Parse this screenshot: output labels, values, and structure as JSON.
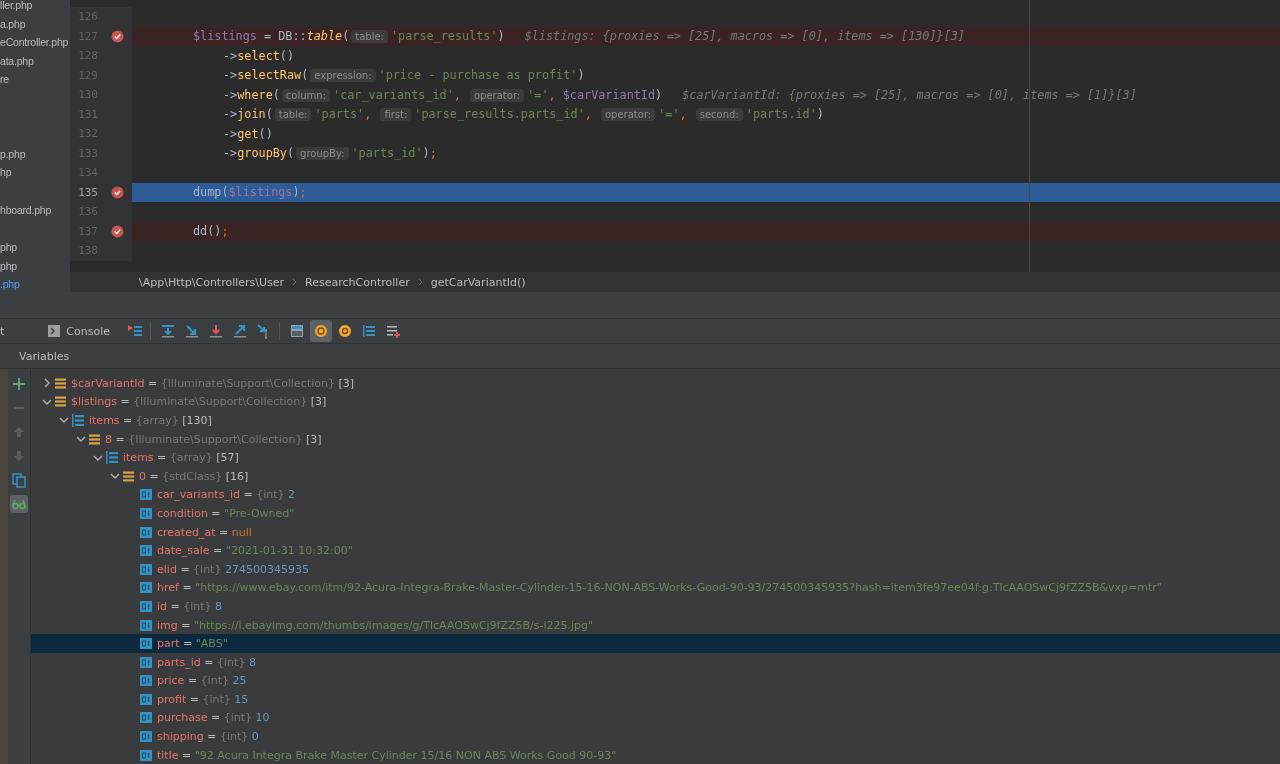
{
  "project_files": [
    {
      "label": "ller.php",
      "selected": false
    },
    {
      "label": "a.php",
      "selected": false
    },
    {
      "label": "eController.php",
      "selected": false
    },
    {
      "label": "ata.php",
      "selected": false
    },
    {
      "label": "re",
      "selected": false
    },
    {
      "label": "p.php",
      "selected": false
    },
    {
      "label": "hp",
      "selected": false
    },
    {
      "label": "hboard.php",
      "selected": false
    },
    {
      "label": "php",
      "selected": false
    },
    {
      "label": "php",
      "selected": false
    },
    {
      "label": ".php",
      "selected": true
    }
  ],
  "editor": {
    "lines": [
      {
        "number": "126",
        "kind": "statement",
        "breakpoint": false,
        "current": false
      },
      {
        "number": "127",
        "kind": "statement",
        "breakpoint": true,
        "current": false,
        "tokens": [
          {
            "kind": "var",
            "text": "$listings"
          },
          {
            "kind": "plain",
            "text": " = DB::"
          },
          {
            "kind": "fn_italic",
            "text": "table"
          },
          {
            "kind": "plain",
            "text": "("
          },
          {
            "kind": "hint",
            "text": "table:"
          },
          {
            "kind": "str",
            "text": "'parse_results'"
          },
          {
            "kind": "plain",
            "text": ")"
          }
        ],
        "inline_value": "$listings: {proxies => [25], macros => [0], items => [130]}[3]"
      },
      {
        "number": "128",
        "kind": "chain",
        "breakpoint": false,
        "current": false,
        "tokens": [
          {
            "kind": "plain",
            "text": "->"
          },
          {
            "kind": "fn",
            "text": "select"
          },
          {
            "kind": "plain",
            "text": "()"
          }
        ]
      },
      {
        "number": "129",
        "kind": "chain",
        "breakpoint": false,
        "current": false,
        "tokens": [
          {
            "kind": "plain",
            "text": "->"
          },
          {
            "kind": "fn",
            "text": "selectRaw"
          },
          {
            "kind": "plain",
            "text": "("
          },
          {
            "kind": "hint",
            "text": "expression:"
          },
          {
            "kind": "str",
            "text": "'price - purchase as profit'"
          },
          {
            "kind": "plain",
            "text": ")"
          }
        ]
      },
      {
        "number": "130",
        "kind": "chain",
        "breakpoint": false,
        "current": false,
        "tokens": [
          {
            "kind": "plain",
            "text": "->"
          },
          {
            "kind": "fn",
            "text": "where"
          },
          {
            "kind": "plain",
            "text": "("
          },
          {
            "kind": "hint",
            "text": "column:"
          },
          {
            "kind": "str",
            "text": "'car_variants_id'"
          },
          {
            "kind": "punct",
            "text": ", "
          },
          {
            "kind": "hint",
            "text": "operator:"
          },
          {
            "kind": "str",
            "text": "'='"
          },
          {
            "kind": "punct",
            "text": ", "
          },
          {
            "kind": "var",
            "text": "$carVariantId"
          },
          {
            "kind": "plain",
            "text": ")"
          }
        ],
        "inline_value": "$carVariantId: {proxies => [25], macros => [0], items => [1]}[3]"
      },
      {
        "number": "131",
        "kind": "chain",
        "breakpoint": false,
        "current": false,
        "tokens": [
          {
            "kind": "plain",
            "text": "->"
          },
          {
            "kind": "fn",
            "text": "join"
          },
          {
            "kind": "plain",
            "text": "("
          },
          {
            "kind": "hint",
            "text": "table:"
          },
          {
            "kind": "str",
            "text": "'parts'"
          },
          {
            "kind": "punct",
            "text": ", "
          },
          {
            "kind": "hint",
            "text": "first:"
          },
          {
            "kind": "str",
            "text": "'parse_results.parts_id'"
          },
          {
            "kind": "punct",
            "text": ", "
          },
          {
            "kind": "hint",
            "text": "operator:"
          },
          {
            "kind": "str",
            "text": "'='"
          },
          {
            "kind": "punct",
            "text": ", "
          },
          {
            "kind": "hint",
            "text": "second:"
          },
          {
            "kind": "str",
            "text": "'parts.id'"
          },
          {
            "kind": "plain",
            "text": ")"
          }
        ]
      },
      {
        "number": "132",
        "kind": "chain",
        "breakpoint": false,
        "current": false,
        "tokens": [
          {
            "kind": "plain",
            "text": "->"
          },
          {
            "kind": "fn",
            "text": "get"
          },
          {
            "kind": "plain",
            "text": "()"
          }
        ]
      },
      {
        "number": "133",
        "kind": "chain",
        "breakpoint": false,
        "current": false,
        "tokens": [
          {
            "kind": "plain",
            "text": "->"
          },
          {
            "kind": "fn",
            "text": "groupBy"
          },
          {
            "kind": "plain",
            "text": "("
          },
          {
            "kind": "hint",
            "text": "groupBy:"
          },
          {
            "kind": "str",
            "text": "'parts_id'"
          },
          {
            "kind": "plain",
            "text": ")"
          },
          {
            "kind": "punct",
            "text": ";"
          }
        ]
      },
      {
        "number": "134",
        "kind": "statement",
        "breakpoint": false,
        "current": false
      },
      {
        "number": "135",
        "kind": "statement",
        "breakpoint": true,
        "current": true,
        "tokens": [
          {
            "kind": "plain",
            "text": "dump("
          },
          {
            "kind": "var",
            "text": "$listings"
          },
          {
            "kind": "plain",
            "text": ")"
          },
          {
            "kind": "punct",
            "text": ";"
          }
        ]
      },
      {
        "number": "136",
        "kind": "statement",
        "breakpoint": false,
        "current": false
      },
      {
        "number": "137",
        "kind": "statement",
        "breakpoint": true,
        "current": false,
        "tokens": [
          {
            "kind": "plain",
            "text": "dd()"
          },
          {
            "kind": "punct",
            "text": ";"
          }
        ]
      },
      {
        "number": "138",
        "kind": "statement",
        "breakpoint": false,
        "current": false
      }
    ]
  },
  "breadcrumbs": [
    "\\App\\Http\\Controllers\\User",
    "ResearchController",
    "getCarVariantId()"
  ],
  "debug": {
    "tab_fragment": "t",
    "console_tab": "Console",
    "variables_title": "Variables",
    "tree": [
      {
        "kind": "object",
        "name": "$carVariantId",
        "assign": "=",
        "type": "{Illuminate\\Support\\Collection}",
        "value": "[3]",
        "expanded": false,
        "selected": false
      },
      {
        "kind": "object",
        "name": "$listings",
        "assign": "=",
        "type": "{Illuminate\\Support\\Collection}",
        "value": "[3]",
        "expanded": true,
        "selected": false,
        "children": [
          {
            "kind": "array",
            "name": "items",
            "assign": "=",
            "type": "{array}",
            "value": "[130]",
            "expanded": true,
            "selected": false,
            "children": [
              {
                "kind": "object",
                "name": "8",
                "assign": "=",
                "type": "{Illuminate\\Support\\Collection}",
                "value": "[3]",
                "expanded": true,
                "selected": false,
                "children": [
                  {
                    "kind": "array",
                    "name": "items",
                    "assign": "=",
                    "type": "{array}",
                    "value": "[57]",
                    "expanded": true,
                    "selected": false,
                    "children": [
                      {
                        "kind": "object",
                        "name": "0",
                        "assign": "=",
                        "type": "{stdClass}",
                        "value": "[16]",
                        "expanded": true,
                        "selected": false,
                        "children": [
                          {
                            "kind": "field_int",
                            "name": "car_variants_id",
                            "assign": "=",
                            "type": "{int}",
                            "value": "2",
                            "selected": false
                          },
                          {
                            "kind": "field_string",
                            "name": "condition",
                            "assign": "=",
                            "value": "\"Pre-Owned\"",
                            "selected": false
                          },
                          {
                            "kind": "field_null",
                            "name": "created_at",
                            "assign": "=",
                            "value": "null",
                            "selected": false
                          },
                          {
                            "kind": "field_string",
                            "name": "date_sale",
                            "assign": "=",
                            "value": "\"2021-01-31 10:32:00\"",
                            "selected": false
                          },
                          {
                            "kind": "field_int",
                            "name": "elid",
                            "assign": "=",
                            "type": "{int}",
                            "value": "274500345935",
                            "selected": false
                          },
                          {
                            "kind": "field_string",
                            "name": "href",
                            "assign": "=",
                            "value": "\"https://www.ebay.com/itm/92-Acura-Integra-Brake-Master-Cylinder-15-16-NON-ABS-Works-Good-90-93/274500345935?hash=item3fe97ee04f:g:TlcAAOSwCj9fZZ5B&vxp=mtr\"",
                            "selected": false
                          },
                          {
                            "kind": "field_int",
                            "name": "id",
                            "assign": "=",
                            "type": "{int}",
                            "value": "8",
                            "selected": false
                          },
                          {
                            "kind": "field_string",
                            "name": "img",
                            "assign": "=",
                            "value": "\"https://i.ebayimg.com/thumbs/images/g/TlcAAOSwCj9fZZ5B/s-l225.jpg\"",
                            "selected": false
                          },
                          {
                            "kind": "field_string",
                            "name": "part",
                            "assign": "=",
                            "value": "\"ABS\"",
                            "selected": true
                          },
                          {
                            "kind": "field_int",
                            "name": "parts_id",
                            "assign": "=",
                            "type": "{int}",
                            "value": "8",
                            "selected": false
                          },
                          {
                            "kind": "field_int",
                            "name": "price",
                            "assign": "=",
                            "type": "{int}",
                            "value": "25",
                            "selected": false
                          },
                          {
                            "kind": "field_int",
                            "name": "profit",
                            "assign": "=",
                            "type": "{int}",
                            "value": "15",
                            "selected": false
                          },
                          {
                            "kind": "field_int",
                            "name": "purchase",
                            "assign": "=",
                            "type": "{int}",
                            "value": "10",
                            "selected": false
                          },
                          {
                            "kind": "field_int",
                            "name": "shipping",
                            "assign": "=",
                            "type": "{int}",
                            "value": "0",
                            "selected": false
                          },
                          {
                            "kind": "field_string",
                            "name": "title",
                            "assign": "=",
                            "value": "\"92 Acura Integra Brake Master Cylinder 15/16 NON ABS Works Good 90-93\"",
                            "selected": false
                          }
                        ]
                      }
                    ]
                  }
                ]
              }
            ]
          }
        ]
      }
    ]
  }
}
